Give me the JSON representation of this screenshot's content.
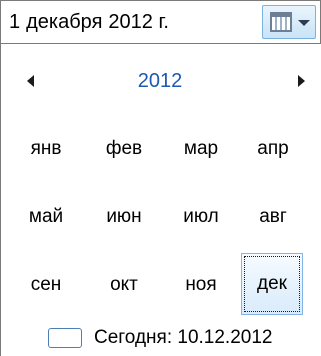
{
  "date_field": {
    "day": "1",
    "month": "декабря",
    "year": "2012 г."
  },
  "dropdown_button": {
    "icon": "calendar-dropdown-icon"
  },
  "calendar": {
    "year": "2012",
    "prev_icon": "triangle-left-icon",
    "next_icon": "triangle-right-icon",
    "months": [
      "янв",
      "фев",
      "мар",
      "апр",
      "май",
      "июн",
      "июл",
      "авг",
      "сен",
      "окт",
      "ноя",
      "дек"
    ],
    "selected_month": "дек"
  },
  "today": {
    "label": "Сегодня: 10.12.2012"
  },
  "colors": {
    "year_title": "#1e58b3",
    "selection_border": "#84b4e6",
    "button_border": "#7ab3dd"
  }
}
